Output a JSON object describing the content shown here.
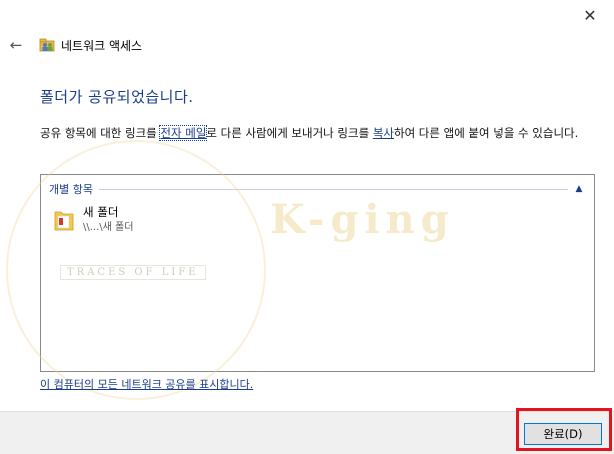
{
  "window": {
    "close_glyph": "✕",
    "back_glyph": "←",
    "title": "네트워크 액세스"
  },
  "main": {
    "heading": "폴더가 공유되었습니다.",
    "desc_part1": "공유 항목에 대한 링크를 ",
    "email_link": "전자 메일",
    "desc_part2": "로 다른 사람에게 보내거나 링크를 ",
    "copy_link": "복사",
    "desc_part3": "하여 다른 앱에 붙여 넣을 수 있습니다."
  },
  "list": {
    "group_label": "개별 항목",
    "group_chevron": "▲",
    "items": [
      {
        "name": "새 폴더",
        "path": "\\\\...\\새 폴더"
      }
    ]
  },
  "watermark": {
    "brand": "K-ging",
    "sub": "TRACES OF LIFE"
  },
  "footer": {
    "show_all_link": "이 컴퓨터의 모든 네트워크 공유를 표시합니다.",
    "finish_button": "완료(D)"
  },
  "colors": {
    "accent": "#1a3c8c",
    "highlight": "#e2141d"
  }
}
